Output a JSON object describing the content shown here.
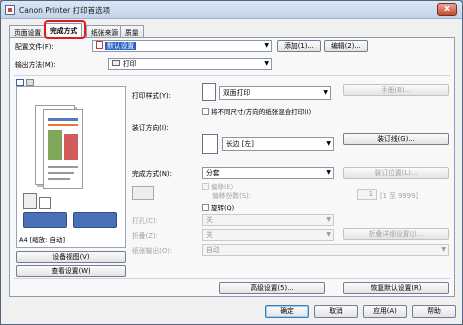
{
  "window": {
    "title": "Canon Printer 打印首选项",
    "close_label": "x"
  },
  "tabs": [
    "页面设置",
    "完成方式",
    "纸张来源",
    "质量"
  ],
  "profile": {
    "label": "配置文件(F):",
    "value": "默认设置",
    "add": "添加(1)...",
    "edit": "编辑(2)..."
  },
  "output": {
    "label": "输出方法(M):",
    "value": "打印"
  },
  "print_style": {
    "label": "打印样式(Y):",
    "value": "双面打印",
    "manual_button": "手册(B)...",
    "mixed_checkbox": "将不同尺寸/方向的纸张混合打印(I)"
  },
  "binding": {
    "label": "装订方向(I):",
    "value": "长边 [左]",
    "button": "装订线(G)..."
  },
  "finishing": {
    "label": "完成方式(N):",
    "value": "分套",
    "position_button": "装订位置(L)...",
    "offset_checkbox": "偏移(E)",
    "offset_count_label": "偏移份数(S):",
    "offset_count": "1",
    "offset_range": "[1 至 9999]",
    "rotate_checkbox": "旋转(Q)",
    "punch_label": "打孔(C):",
    "punch_value": "关",
    "fold_label": "折叠(Z):",
    "fold_value": "关",
    "fold_detail_button": "折叠详细设置(J)...",
    "output_label": "纸张输出(O):",
    "output_value": "自动"
  },
  "preview": {
    "info": "A4 [缩放: 自动]",
    "device_button": "设备视图(V)",
    "view_button": "查看设置(W)"
  },
  "bottom": {
    "advanced": "高级设置(5)...",
    "restore": "恢复默认设置(R)"
  },
  "dialog": {
    "ok": "确定",
    "cancel": "取消",
    "apply": "应用(A)",
    "help": "帮助"
  },
  "colors": {
    "highlight_red": "#e01b1b",
    "selection_blue": "#2b62c4"
  }
}
